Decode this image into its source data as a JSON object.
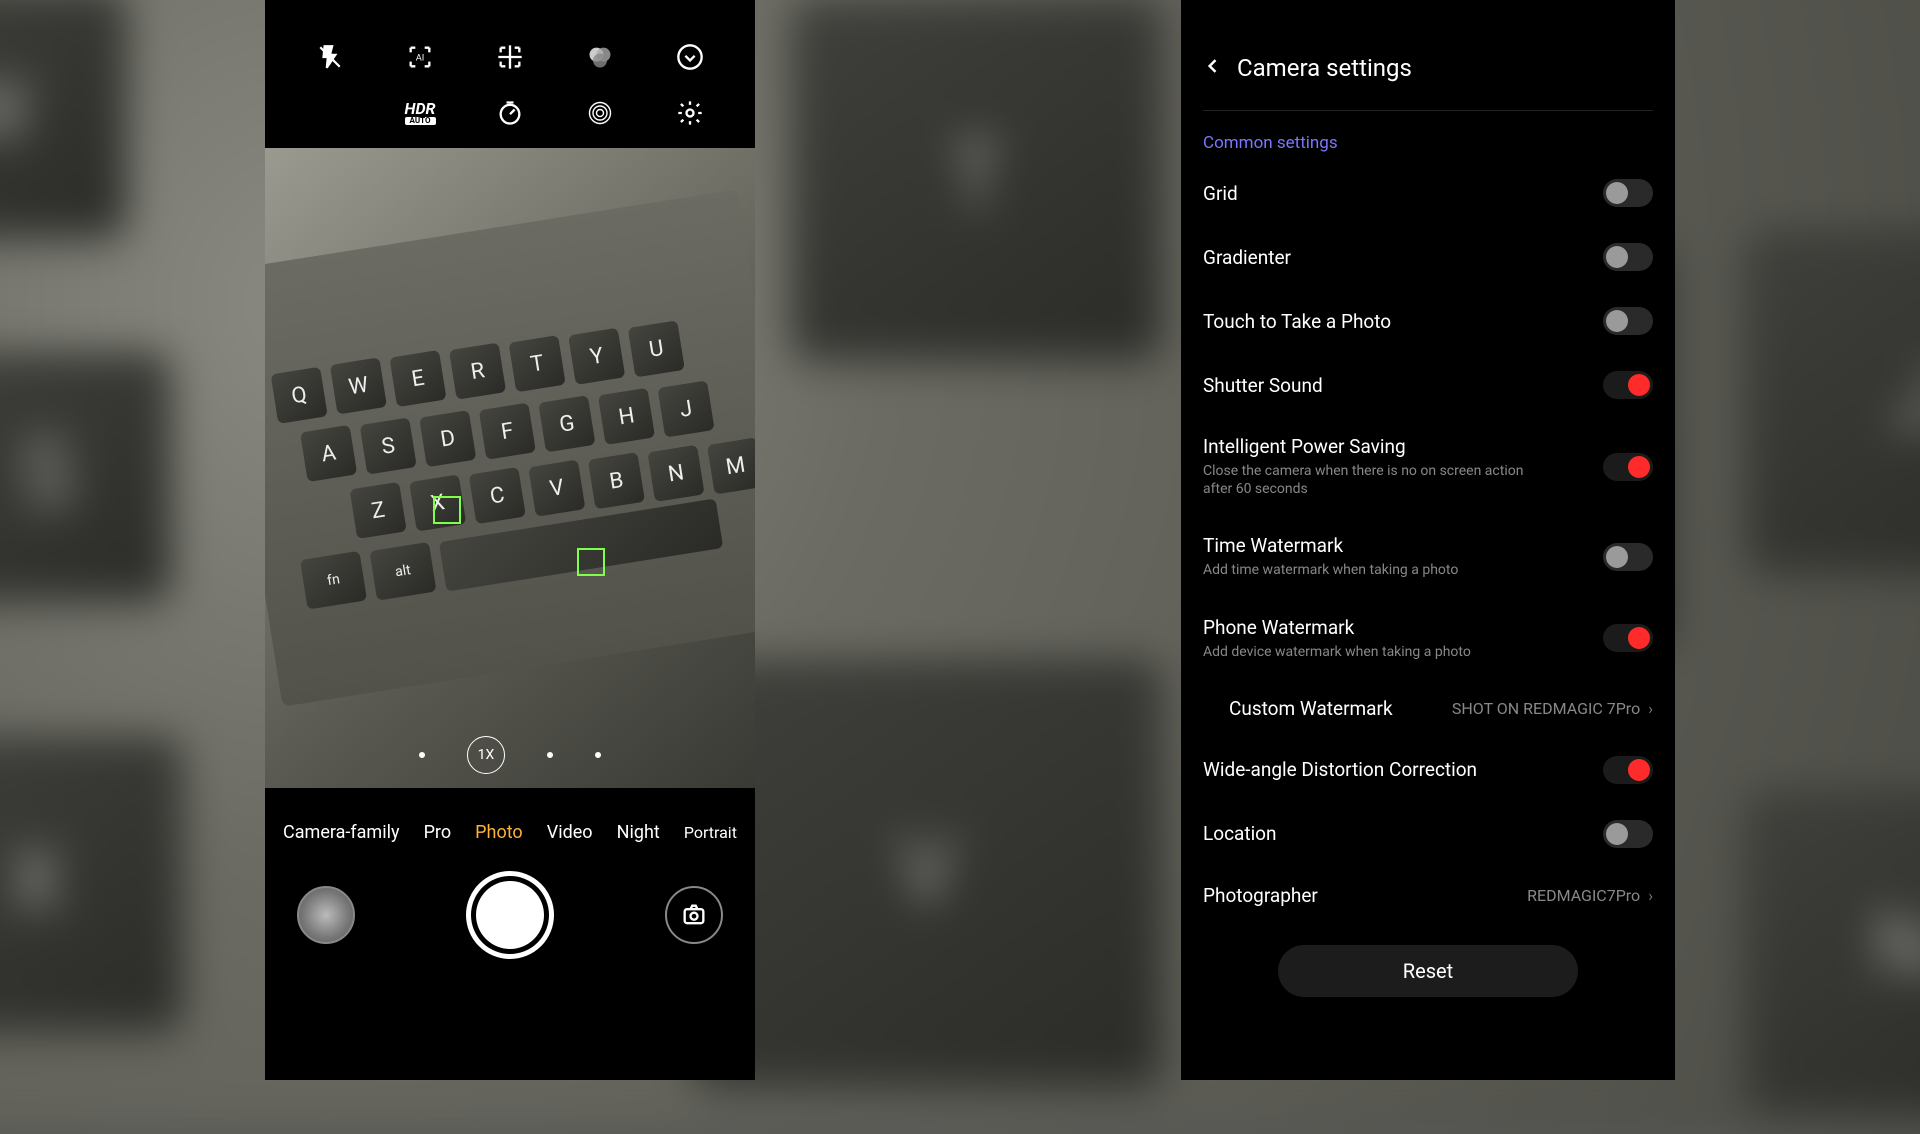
{
  "camera": {
    "top_icons": [
      "flash-off",
      "ai-frame",
      "focus-frame",
      "filters",
      "timer-dropdown",
      "hdr-auto",
      "timer-off",
      "live-focus",
      "settings-gear"
    ],
    "hdr_label": "HDR",
    "hdr_sub": "AUTO",
    "zoom_label": "1X",
    "modes": [
      "Camera-family",
      "Pro",
      "Photo",
      "Video",
      "Night",
      "Portrait"
    ],
    "active_mode_index": 2
  },
  "settings": {
    "title": "Camera settings",
    "section": "Common settings",
    "items": [
      {
        "title": "Grid",
        "on": false
      },
      {
        "title": "Gradienter",
        "on": false
      },
      {
        "title": "Touch to Take a Photo",
        "on": false
      },
      {
        "title": "Shutter Sound",
        "on": true
      },
      {
        "title": "Intelligent Power Saving",
        "sub": "Close the camera when there is no on screen action after 60 seconds",
        "on": true
      },
      {
        "title": "Time Watermark",
        "sub": "Add time watermark when taking a photo",
        "on": false
      },
      {
        "title": "Phone Watermark",
        "sub": "Add device watermark when taking a photo",
        "on": true
      }
    ],
    "custom_watermark_label": "Custom Watermark",
    "custom_watermark_value": "SHOT ON REDMAGIC 7Pro",
    "wide_angle": {
      "title": "Wide-angle Distortion Correction",
      "on": true
    },
    "location": {
      "title": "Location",
      "on": false
    },
    "photographer": {
      "title": "Photographer",
      "value": "REDMAGIC7Pro"
    },
    "reset": "Reset"
  }
}
